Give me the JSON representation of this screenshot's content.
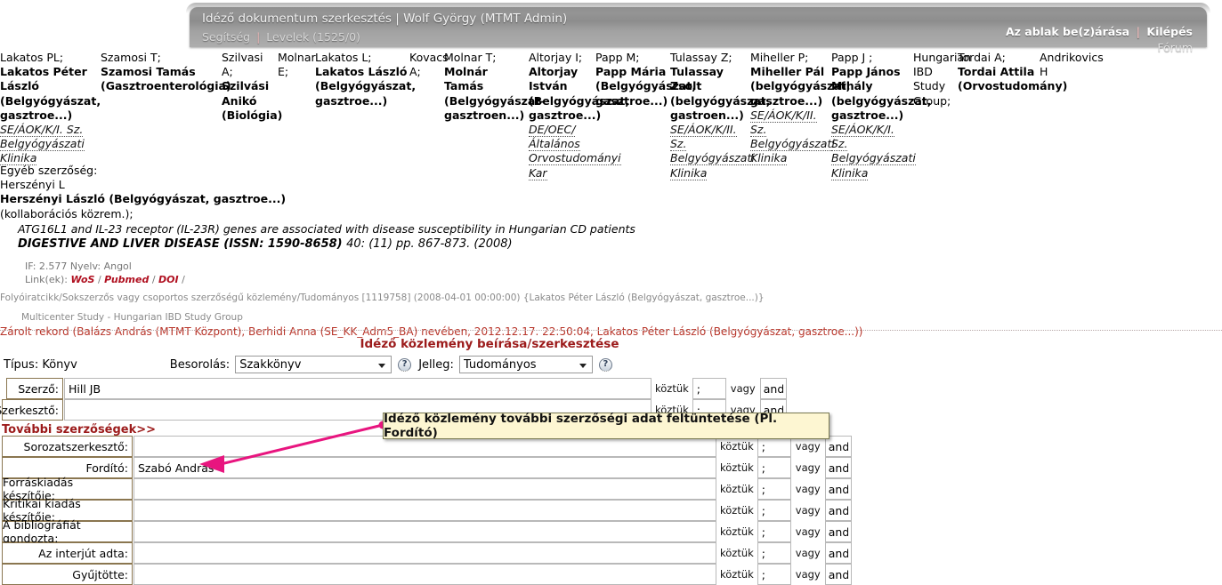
{
  "header": {
    "title": "Idéző dokumentum szerkesztés | Wolf György (MTMT Admin)",
    "help_label": "Segítség",
    "messages_label": "Levelek (1525/0)",
    "close_window": "Az ablak be(z)árása",
    "logout": "Kilépés",
    "forum": "Fórum",
    "separator": "|"
  },
  "authors": [
    {
      "short": "Lakatos PL;",
      "full": "Lakatos Péter László (Belgyógyászat, gasztroe...)",
      "institution": "SE/ÁOK/K/I. Sz. Belgyógyászati Klinika"
    },
    {
      "short": "Szamosi T;",
      "full": "Szamosi Tamás (Gasztroenterológia)",
      "institution": ""
    },
    {
      "short": "Szilvasi A;",
      "full": "Szilvási Anikó (Biológia)",
      "institution": ""
    },
    {
      "short": "Molnar E;",
      "full": "",
      "institution": ""
    },
    {
      "short": "Lakatos L;",
      "full": "Lakatos László (Belgyógyászat, gasztroe...)",
      "institution": ""
    },
    {
      "short": "Kovacs A;",
      "full": "",
      "institution": ""
    },
    {
      "short": "Molnar T;",
      "full": "Molnár Tamás (Belgyógyászat-gasztroen...)",
      "institution": ""
    },
    {
      "short": "Altorjay I;",
      "full": "Altorjay István (Belgyógyászat, gasztroe...)",
      "institution": "DE/OEC/Általános Orvostudományi Kar"
    },
    {
      "short": "Papp M;",
      "full": "Papp Mária (Belgyógyászat, gasztroe...)",
      "institution": ""
    },
    {
      "short": "Tulassay Z;",
      "full": "Tulassay Zsolt (belgyógyászat, gastroen...)",
      "institution": "SE/ÁOK/K/II. Sz. Belgyógyászati Klinika"
    },
    {
      "short": "Miheller P;",
      "full": "Miheller Pál (belgyógyászat, gasztroe...)",
      "institution": "SE/ÁOK/K/II. Sz. Belgyógyászati Klinika"
    },
    {
      "short": "Papp J ;",
      "full": "Papp János Mihály (belgyógyászat, gasztroe...)",
      "institution": "SE/ÁOK/K/I. Sz. Belgyógyászati Klinika"
    },
    {
      "short": "Hungarian IBD Study Group;",
      "full": "",
      "institution": ""
    },
    {
      "short": "Tordai A;",
      "full": "Tordai Attila (Orvostudomány)",
      "institution": ""
    },
    {
      "short": "Andrikovics H",
      "full": "",
      "institution": ""
    }
  ],
  "record": {
    "other_authorship_label": "Egyéb szerzőség:",
    "other_author_short": "Herszényi L",
    "other_author_full": "Herszényi László (Belgyógyászat, gasztroe...)",
    "collaboration_note": "(kollaborációs közrem.);",
    "title": "ATG16L1 and IL-23 receptor (IL-23R) genes are associated with disease susceptibility in Hungarian CD patients",
    "journal": "DIGESTIVE AND LIVER DISEASE (ISSN: 1590-8658)",
    "volume_info": "40: (11) pp. 867-873. (2008)",
    "impact": "IF: 2.577 Nyelv: Angol",
    "links_label": "Link(ek):",
    "links": [
      "WoS",
      "Pubmed",
      "DOI"
    ],
    "link_separator": "/",
    "meta": "Folyóiratcikk/Sokszerzős vagy csoportos szerzőségű közlemény/Tudományos [1119758] (2008-04-01 00:00:00) {Lakatos Péter László (Belgyógyászat, gasztroe...)}",
    "study_group": "Multicenter Study - Hungarian IBD Study Group",
    "locked": "Zárolt rekord (Balázs András (MTMT Központ), Berhidi Anna (SE_KK_Adm5_BA) nevében, 2012.12.17. 22:50:04, Lakatos Péter László (Belgyógyászat, gasztroe...))"
  },
  "form": {
    "title": "Idéző közlemény beírása/szerkesztése",
    "type_label": "Típus: Könyv",
    "besorolas_label": "Besorolás:",
    "besorolas_value": "Szakkönyv",
    "besorolas_options": [
      "Szakkönyv"
    ],
    "jelleg_label": "Jelleg:",
    "jelleg_value": "Tudományos",
    "jelleg_options": [
      "Tudományos"
    ],
    "help_icon": "?",
    "more_authorship_label": "További szerzőségek>>",
    "between_label": "köztük",
    "or_label": "vagy",
    "separator_value": ";",
    "and_value": "and",
    "rows": [
      {
        "label": "Szerző:",
        "value": "Hill JB"
      },
      {
        "label": "Szerkesztő:",
        "value": ""
      },
      {
        "label": "Sorozatszerkesztő:",
        "value": ""
      },
      {
        "label": "Fordító:",
        "value": "Szabó András"
      },
      {
        "label": "Forráskiadás készítője:",
        "value": ""
      },
      {
        "label": "Kritikai kiadás készítője:",
        "value": ""
      },
      {
        "label": "A bibliográfiát gondozta:",
        "value": ""
      },
      {
        "label": "Az interjút adta:",
        "value": ""
      },
      {
        "label": "Gyűjtötte:",
        "value": ""
      }
    ]
  },
  "callout": {
    "text": "Idéző közlemény további szerzőségi adat feltüntetése (Pl. Fordító)",
    "color": "#e8157f"
  }
}
